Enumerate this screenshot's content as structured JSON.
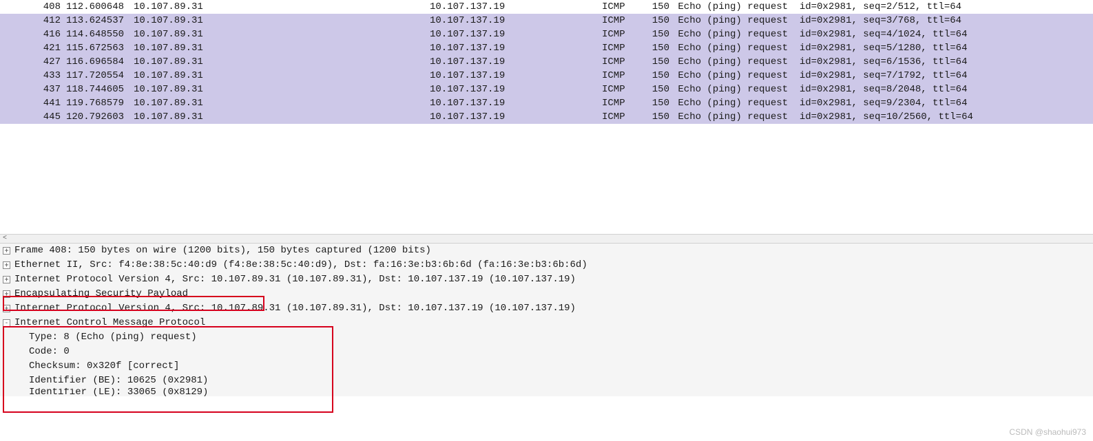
{
  "packets": [
    {
      "no": "408",
      "time": "112.600648",
      "src": "10.107.89.31",
      "dst": "10.107.137.19",
      "proto": "ICMP",
      "len": "150",
      "info": "Echo (ping) request  id=0x2981, seq=2/512, ttl=64",
      "hl": false
    },
    {
      "no": "412",
      "time": "113.624537",
      "src": "10.107.89.31",
      "dst": "10.107.137.19",
      "proto": "ICMP",
      "len": "150",
      "info": "Echo (ping) request  id=0x2981, seq=3/768, ttl=64",
      "hl": true
    },
    {
      "no": "416",
      "time": "114.648550",
      "src": "10.107.89.31",
      "dst": "10.107.137.19",
      "proto": "ICMP",
      "len": "150",
      "info": "Echo (ping) request  id=0x2981, seq=4/1024, ttl=64",
      "hl": true
    },
    {
      "no": "421",
      "time": "115.672563",
      "src": "10.107.89.31",
      "dst": "10.107.137.19",
      "proto": "ICMP",
      "len": "150",
      "info": "Echo (ping) request  id=0x2981, seq=5/1280, ttl=64",
      "hl": true
    },
    {
      "no": "427",
      "time": "116.696584",
      "src": "10.107.89.31",
      "dst": "10.107.137.19",
      "proto": "ICMP",
      "len": "150",
      "info": "Echo (ping) request  id=0x2981, seq=6/1536, ttl=64",
      "hl": true
    },
    {
      "no": "433",
      "time": "117.720554",
      "src": "10.107.89.31",
      "dst": "10.107.137.19",
      "proto": "ICMP",
      "len": "150",
      "info": "Echo (ping) request  id=0x2981, seq=7/1792, ttl=64",
      "hl": true
    },
    {
      "no": "437",
      "time": "118.744605",
      "src": "10.107.89.31",
      "dst": "10.107.137.19",
      "proto": "ICMP",
      "len": "150",
      "info": "Echo (ping) request  id=0x2981, seq=8/2048, ttl=64",
      "hl": true
    },
    {
      "no": "441",
      "time": "119.768579",
      "src": "10.107.89.31",
      "dst": "10.107.137.19",
      "proto": "ICMP",
      "len": "150",
      "info": "Echo (ping) request  id=0x2981, seq=9/2304, ttl=64",
      "hl": true
    },
    {
      "no": "445",
      "time": "120.792603",
      "src": "10.107.89.31",
      "dst": "10.107.137.19",
      "proto": "ICMP",
      "len": "150",
      "info": "Echo (ping) request  id=0x2981, seq=10/2560, ttl=64",
      "hl": true
    }
  ],
  "details": {
    "frame": "Frame 408: 150 bytes on wire (1200 bits), 150 bytes captured (1200 bits)",
    "eth": "Ethernet II, Src: f4:8e:38:5c:40:d9 (f4:8e:38:5c:40:d9), Dst: fa:16:3e:b3:6b:6d (fa:16:3e:b3:6b:6d)",
    "ip1": "Internet Protocol Version 4, Src: 10.107.89.31 (10.107.89.31), Dst: 10.107.137.19 (10.107.137.19)",
    "esp": "Encapsulating Security Payload",
    "ip2": "Internet Protocol Version 4, Src: 10.107.89.31 (10.107.89.31), Dst: 10.107.137.19 (10.107.137.19)",
    "icmp": "Internet Control Message Protocol",
    "icmp_type": "Type: 8 (Echo (ping) request)",
    "icmp_code": "Code: 0",
    "icmp_checksum": "Checksum: 0x320f [correct]",
    "icmp_id_be": "Identifier (BE): 10625 (0x2981)",
    "icmp_id_le": "Identifier (LE): 33065 (0x8129)"
  },
  "watermark": "CSDN @shaohui973",
  "chevron": "<"
}
